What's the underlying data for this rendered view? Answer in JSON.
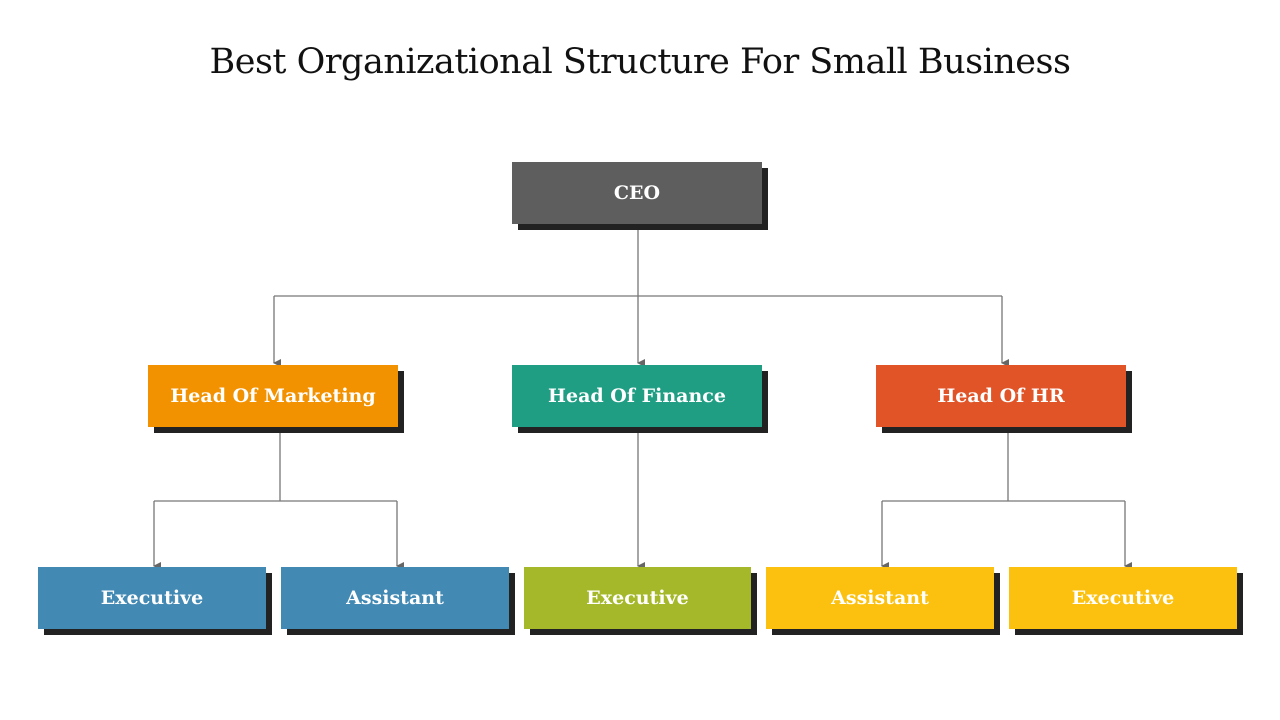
{
  "title": "Best Organizational Structure For Small Business",
  "nodes": {
    "ceo": {
      "label": "CEO",
      "color": "#5e5e5e"
    },
    "head_marketing": {
      "label": "Head Of Marketing",
      "color": "#f39200"
    },
    "head_finance": {
      "label": "Head Of Finance",
      "color": "#1f9e84"
    },
    "head_hr": {
      "label": "Head Of HR",
      "color": "#e05427"
    },
    "marketing_executive": {
      "label": "Executive",
      "color": "#4289b4"
    },
    "marketing_assistant": {
      "label": "Assistant",
      "color": "#4289b4"
    },
    "finance_executive": {
      "label": "Executive",
      "color": "#a5b82a"
    },
    "hr_assistant": {
      "label": "Assistant",
      "color": "#fbc10e"
    },
    "hr_executive": {
      "label": "Executive",
      "color": "#fbc10e"
    }
  },
  "connector_color": "#777777"
}
